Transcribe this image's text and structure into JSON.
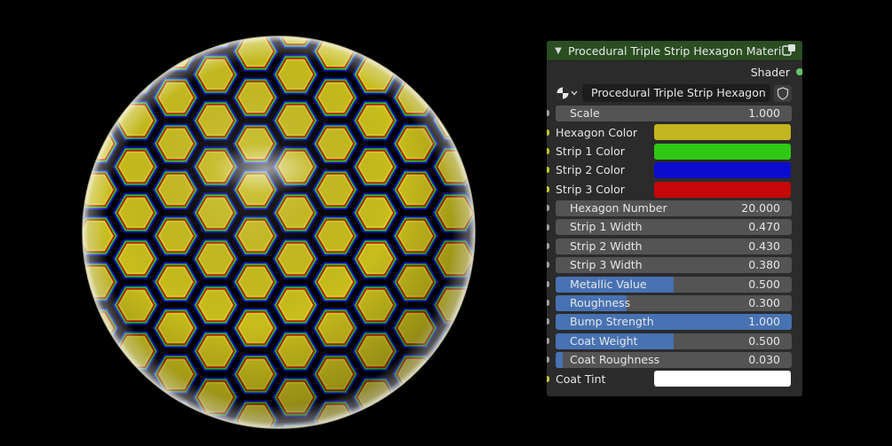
{
  "node": {
    "title": "Procedural Triple Strip Hexagon Material",
    "output_label": "Shader",
    "group_name": "Procedural Triple Strip Hexagon ...",
    "header_color": "#2a4d22",
    "socket_color_shader": "#63c763",
    "icons": {
      "collapse": "chevron-down-icon",
      "header": "node-tree-icon",
      "group": "material-sphere-icon",
      "dropdown": "chevron-down-icon",
      "fake_user": "shield-icon"
    }
  },
  "inputs": [
    {
      "name": "Scale",
      "kind": "value",
      "value": "1.000",
      "fill": 0
    },
    {
      "name": "Hexagon Color",
      "kind": "color",
      "color": "#c2b51f"
    },
    {
      "name": "Strip 1 Color",
      "kind": "color",
      "color": "#2ec815"
    },
    {
      "name": "Strip 2 Color",
      "kind": "color",
      "color": "#0c0cce"
    },
    {
      "name": "Strip 3 Color",
      "kind": "color",
      "color": "#c40707"
    },
    {
      "name": "Hexagon Number",
      "kind": "value",
      "value": "20.000",
      "fill": 0
    },
    {
      "name": "Strip 1 Width",
      "kind": "value",
      "value": "0.470",
      "fill": 0
    },
    {
      "name": "Strip 2 Width",
      "kind": "value",
      "value": "0.430",
      "fill": 0
    },
    {
      "name": "Strip 3 Width",
      "kind": "value",
      "value": "0.380",
      "fill": 0
    },
    {
      "name": "Metallic Value",
      "kind": "factor",
      "value": "0.500",
      "fill": 0.5
    },
    {
      "name": "Roughness",
      "kind": "factor",
      "value": "0.300",
      "fill": 0.3
    },
    {
      "name": "Bump Strength",
      "kind": "factor",
      "value": "1.000",
      "fill": 1.0
    },
    {
      "name": "Coat Weight",
      "kind": "factor",
      "value": "0.500",
      "fill": 0.5
    },
    {
      "name": "Coat Roughness",
      "kind": "factor",
      "value": "0.030",
      "fill": 0.03
    },
    {
      "name": "Coat Tint",
      "kind": "color",
      "color": "#ffffff"
    }
  ],
  "preview": {
    "hexagon_color": "#c8bd1c",
    "strip_colors": [
      "#2ec815",
      "#0c0cce",
      "#c40707"
    ],
    "background": "#000000"
  }
}
